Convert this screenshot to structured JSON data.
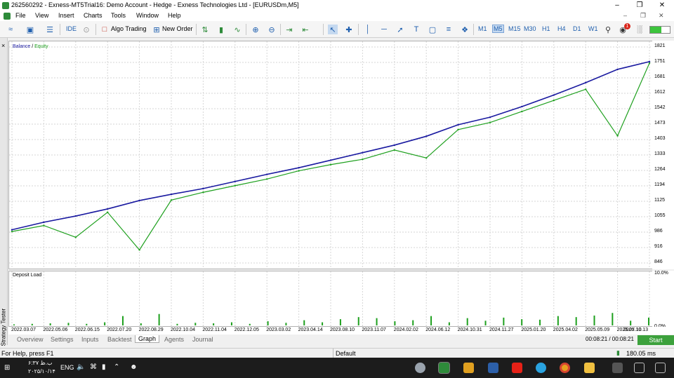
{
  "window": {
    "title": "262560292 - Exness-MT5Trial16: Demo Account - Hedge - Exness Technologies Ltd - [EURUSDm,M5]"
  },
  "menu": {
    "items": [
      "File",
      "View",
      "Insert",
      "Charts",
      "Tools",
      "Window",
      "Help"
    ]
  },
  "toolbar": {
    "algo_trading_label": "Algo Trading",
    "new_order_label": "New Order",
    "ide_label": "IDE",
    "timeframes": [
      "M1",
      "M5",
      "M15",
      "M30",
      "H1",
      "H4",
      "D1",
      "W1"
    ],
    "active_timeframe": "M5",
    "notification_count": "1"
  },
  "side_panel": {
    "label": "Strategy Tester",
    "close": "×"
  },
  "chart": {
    "legend_balance": "Balance",
    "legend_sep": " / ",
    "legend_equity": "Equity",
    "y_labels": [
      "1821",
      "1751",
      "1681",
      "1612",
      "1542",
      "1473",
      "1403",
      "1333",
      "1264",
      "1194",
      "1125",
      "1055",
      "986",
      "916",
      "846"
    ],
    "x_labels": [
      "2022.03.07",
      "2022.05.06",
      "2022.06.15",
      "2022.07.20",
      "2022.08.29",
      "2022.10.04",
      "2022.11.04",
      "2022.12.05",
      "2023.03.02",
      "2023.04.14",
      "2023.08.10",
      "2023.11.07",
      "2024.02.02",
      "2024.06.12",
      "2024.10.31",
      "2024.11.27",
      "2025.01.20",
      "2025.04.02",
      "2025.05.09",
      "2025.07.10",
      "2025.10.13"
    ],
    "colors": {
      "balance": "#1a1aa0",
      "equity": "#1ea01e",
      "grid": "#d6d6d6",
      "load": "#1ea01e"
    }
  },
  "chart_data": {
    "type": "line",
    "title": "",
    "xlabel": "",
    "ylabel": "",
    "ylim": [
      846,
      1821
    ],
    "x_range": [
      "2022.03.07",
      "2025.10.13"
    ],
    "series": [
      {
        "name": "Balance",
        "x": [
          "2022.03.07",
          "2022.05.06",
          "2022.06.15",
          "2022.07.20",
          "2022.08.29",
          "2022.10.04",
          "2022.11.04",
          "2022.12.05",
          "2023.03.02",
          "2023.04.14",
          "2023.08.10",
          "2023.11.07",
          "2024.02.02",
          "2024.06.12",
          "2024.10.31",
          "2024.11.27",
          "2025.01.20",
          "2025.04.02",
          "2025.05.09",
          "2025.07.10",
          "2025.10.13"
        ],
        "values": [
          996,
          1030,
          1058,
          1090,
          1128,
          1156,
          1182,
          1214,
          1246,
          1276,
          1310,
          1344,
          1378,
          1418,
          1470,
          1504,
          1552,
          1604,
          1660,
          1720,
          1755
        ]
      },
      {
        "name": "Equity",
        "x": [
          "2022.03.07",
          "2022.05.06",
          "2022.06.15",
          "2022.07.20",
          "2022.08.29",
          "2022.10.04",
          "2022.11.04",
          "2022.12.05",
          "2023.03.02",
          "2023.04.14",
          "2023.08.10",
          "2023.11.07",
          "2024.02.02",
          "2024.06.12",
          "2024.10.31",
          "2024.11.27",
          "2025.01.20",
          "2025.04.02",
          "2025.05.09",
          "2025.07.10",
          "2025.10.13"
        ],
        "values": [
          988,
          1015,
          962,
          1075,
          905,
          1130,
          1165,
          1195,
          1225,
          1262,
          1290,
          1314,
          1356,
          1320,
          1448,
          1480,
          1530,
          1580,
          1630,
          1420,
          1748
        ]
      }
    ],
    "deposit_load": {
      "name": "Deposit Load",
      "y_labels": [
        "10.0%",
        "0.0%"
      ],
      "values_pct": [
        0.2,
        0.3,
        0.4,
        0.5,
        0.3,
        0.6,
        1.8,
        0.4,
        2.2,
        0.3,
        0.5,
        0.4,
        0.6,
        0.3,
        0.8,
        0.5,
        1.0,
        0.6,
        1.2,
        1.6,
        1.4,
        0.8,
        1.0,
        1.8,
        0.6,
        1.4,
        0.9,
        1.5,
        1.2,
        1.1,
        1.8,
        1.6,
        1.9,
        2.4,
        0.9,
        1.5
      ]
    }
  },
  "bottom_tabs": [
    "Overview",
    "Settings",
    "Inputs",
    "Backtest",
    "Graph",
    "Agents",
    "Journal"
  ],
  "active_bottom_tab": "Graph",
  "tester": {
    "timer": "00:08:21 / 00:08:21",
    "start_label": "Start"
  },
  "status": {
    "help": "For Help, press F1",
    "profile": "Default",
    "ping": "180.05 ms"
  },
  "taskbar": {
    "time": "۶:۳۷ ب.ظ",
    "date": "۲۰۲۵/۱۰/۱۴",
    "lang": "ENG"
  }
}
